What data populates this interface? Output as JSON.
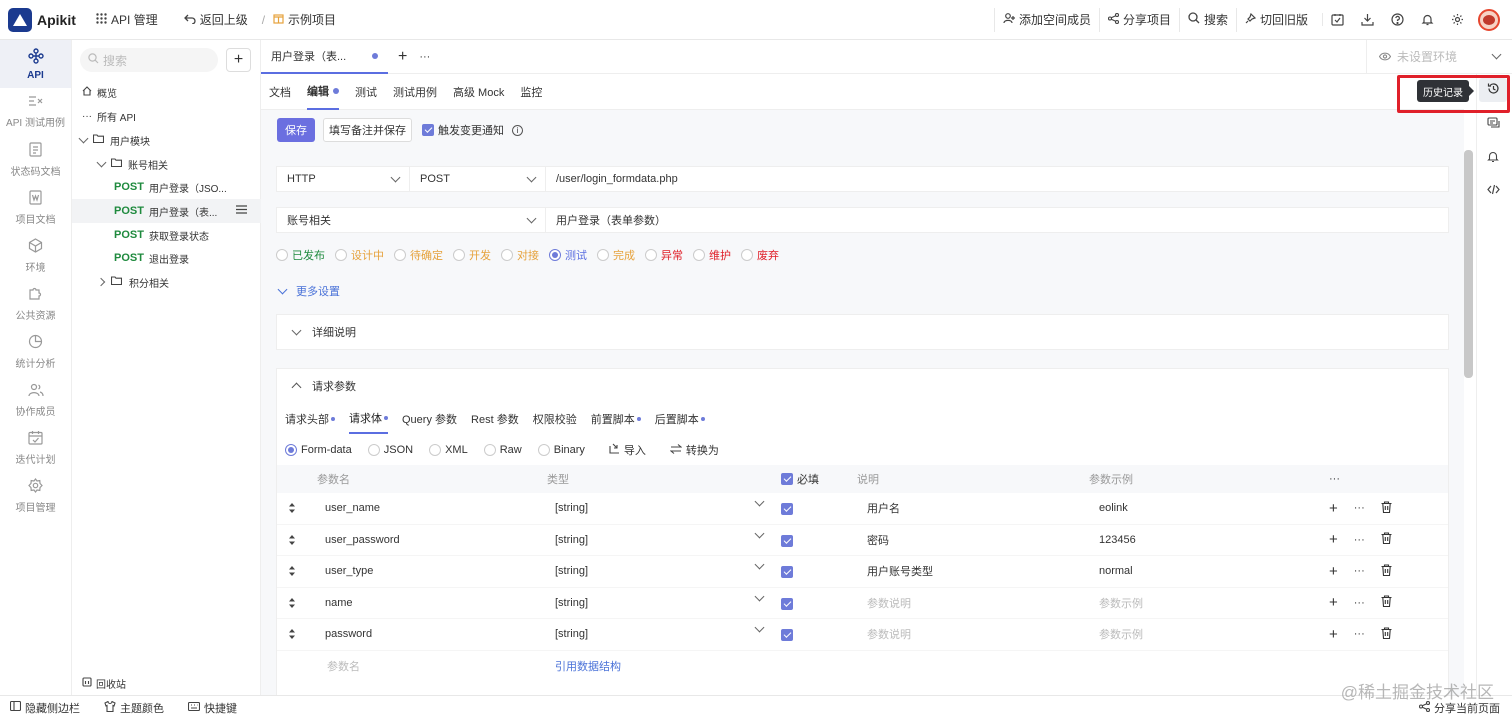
{
  "topbar": {
    "logo_text": "Apikit",
    "api_manage": "API 管理",
    "back": "返回上级",
    "separator": "/",
    "project": "示例项目",
    "add_member": "添加空间成员",
    "share": "分享项目",
    "search": "搜索",
    "switch_old": "切回旧版"
  },
  "left_nav": [
    {
      "label": "API",
      "icon": "api-icon"
    },
    {
      "label": "API 测试用例",
      "icon": "test-case-icon"
    },
    {
      "label": "状态码文档",
      "icon": "status-code-icon"
    },
    {
      "label": "项目文档",
      "icon": "document-icon"
    },
    {
      "label": "环境",
      "icon": "environment-icon"
    },
    {
      "label": "公共资源",
      "icon": "puzzle-icon"
    },
    {
      "label": "统计分析",
      "icon": "pie-chart-icon"
    },
    {
      "label": "协作成员",
      "icon": "users-icon"
    },
    {
      "label": "迭代计划",
      "icon": "calendar-icon"
    },
    {
      "label": "项目管理",
      "icon": "gear-icon"
    }
  ],
  "tree": {
    "search_placeholder": "搜索",
    "overview": "概览",
    "all_api": "所有 API",
    "user_module": "用户模块",
    "account_group": "账号相关",
    "method": "POST",
    "apis": [
      "用户登录（JSO...",
      "用户登录（表...",
      "获取登录状态",
      "退出登录"
    ],
    "points_group": "积分相关",
    "recycle": "回收站"
  },
  "bottom_bar": {
    "hide_sidebar": "隐藏侧边栏",
    "theme": "主题颜色",
    "shortcut": "快捷键",
    "share_page": "分享当前页面",
    "watermark": "@稀土掘金技术社区"
  },
  "editor": {
    "tab_title": "用户登录（表...",
    "env_placeholder": "未设置环境",
    "subtabs": [
      "文档",
      "编辑",
      "测试",
      "测试用例",
      "高级 Mock",
      "监控"
    ],
    "save": "保存",
    "save_with_note": "填写备注并保存",
    "trigger_notify": "触发变更通知",
    "protocol": "HTTP",
    "method": "POST",
    "url": "/user/login_formdata.php",
    "group": "账号相关",
    "name": "用户登录（表单参数）",
    "statuses": [
      {
        "label": "已发布",
        "color": "#1f8a3e"
      },
      {
        "label": "设计中",
        "color": "#e6a23c"
      },
      {
        "label": "待确定",
        "color": "#e6a23c"
      },
      {
        "label": "开发",
        "color": "#e6a23c"
      },
      {
        "label": "对接",
        "color": "#e6a23c"
      },
      {
        "label": "测试",
        "color": "#5b6ee1"
      },
      {
        "label": "完成",
        "color": "#e6a23c"
      },
      {
        "label": "异常",
        "color": "#e0202a"
      },
      {
        "label": "维护",
        "color": "#e0202a"
      },
      {
        "label": "废弃",
        "color": "#e0202a"
      }
    ],
    "more_settings": "更多设置",
    "detail": "详细说明",
    "request_params": "请求参数",
    "param_tabs": [
      "请求头部",
      "请求体",
      "Query 参数",
      "Rest 参数",
      "权限校验",
      "前置脚本",
      "后置脚本"
    ],
    "body_types": [
      "Form-data",
      "JSON",
      "XML",
      "Raw",
      "Binary"
    ],
    "import": "导入",
    "convert": "转换为",
    "columns": {
      "name": "参数名",
      "type": "类型",
      "required": "必填",
      "desc": "说明",
      "example": "参数示例",
      "more": "···"
    },
    "rows": [
      {
        "name": "user_name",
        "type": "[string]",
        "desc": "用户名",
        "example": "eolink"
      },
      {
        "name": "user_password",
        "type": "[string]",
        "desc": "密码",
        "example": "123456"
      },
      {
        "name": "user_type",
        "type": "[string]",
        "desc": "用户账号类型",
        "example": "normal"
      },
      {
        "name": "name",
        "type": "[string]",
        "desc": "参数说明",
        "example": "参数示例"
      },
      {
        "name": "password",
        "type": "[string]",
        "desc": "参数说明",
        "example": "参数示例"
      }
    ],
    "new_row_placeholder": "参数名",
    "ref_struct": "引用数据结构"
  },
  "history_tooltip": "历史记录"
}
